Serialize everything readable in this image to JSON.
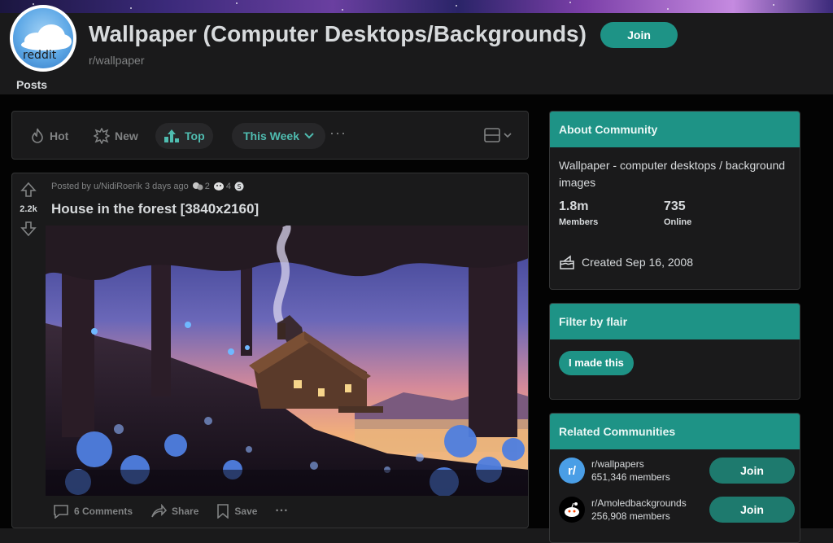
{
  "subreddit": {
    "title": "Wallpaper (Computer Desktops/Backgrounds)",
    "name": "r/wallpaper",
    "join_label": "Join",
    "avatar_text": "reddit"
  },
  "tabs": {
    "posts": "Posts"
  },
  "sort": {
    "hot": "Hot",
    "new": "New",
    "top": "Top",
    "time_range": "This Week",
    "more": "···"
  },
  "post": {
    "meta": "Posted by u/NidiRoerik 3 days ago",
    "awards": [
      {
        "icon": "helpful-award-icon",
        "count": "2"
      },
      {
        "icon": "wholesome-award-icon",
        "count": "4"
      },
      {
        "icon": "silver-award-icon",
        "count": ""
      }
    ],
    "votes": "2.2k",
    "title": "House in the forest [3840x2160]",
    "comments": "6 Comments",
    "share": "Share",
    "save": "Save",
    "more": "···"
  },
  "about": {
    "header": "About Community",
    "description": "Wallpaper - computer desktops / background images",
    "members_value": "1.8m",
    "members_label": "Members",
    "online_value": "735",
    "online_label": "Online",
    "created": "Created Sep 16, 2008"
  },
  "filter": {
    "header": "Filter by flair",
    "flair": "I made this"
  },
  "related": {
    "header": "Related Communities",
    "items": [
      {
        "name": "r/wallpapers",
        "members": "651,346 members",
        "join": "Join",
        "icon": "r/"
      },
      {
        "name": "r/Amoledbackgrounds",
        "members": "256,908 members",
        "join": "Join",
        "icon": "snoo"
      }
    ]
  },
  "colors": {
    "accent": "#1e9386",
    "active_text": "#4fbcb0",
    "background": "#030303",
    "card": "#1a1a1b"
  }
}
